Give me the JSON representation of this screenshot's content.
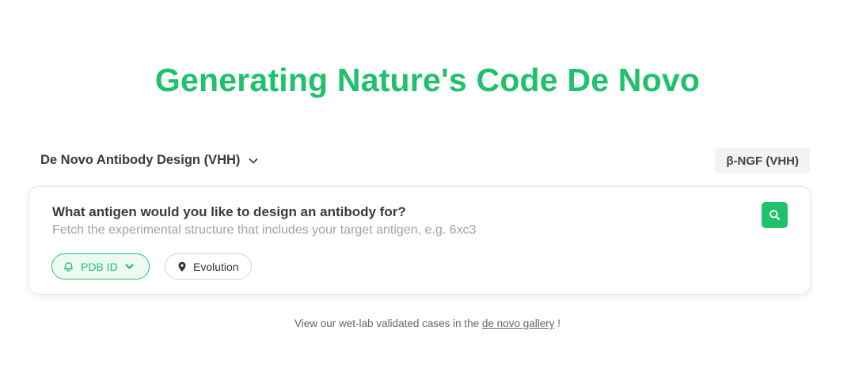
{
  "hero": {
    "title": "Generating Nature's Code De Novo"
  },
  "mode": {
    "selected": "De Novo Antibody Design (VHH)",
    "icon": "chevron-down-icon"
  },
  "example": {
    "label": "β-NGF (VHH)"
  },
  "card": {
    "question": "What antigen would you like to design an antibody for?",
    "hint": "Fetch the experimental structure that includes your target antigen, e.g. 6xc3",
    "search_icon": "search-icon",
    "pills": [
      {
        "label": "PDB ID",
        "icon": "bell-icon",
        "active": true
      },
      {
        "label": "Evolution",
        "icon": "location-pin-icon",
        "active": false
      }
    ]
  },
  "footer": {
    "prefix": "View our wet-lab validated cases in the",
    "link": "de novo gallery",
    "suffix": "!"
  },
  "colors": {
    "accent": "#1fc16b",
    "pill_active_bg": "#edfaf2",
    "chip_bg": "#f2f3f5"
  }
}
